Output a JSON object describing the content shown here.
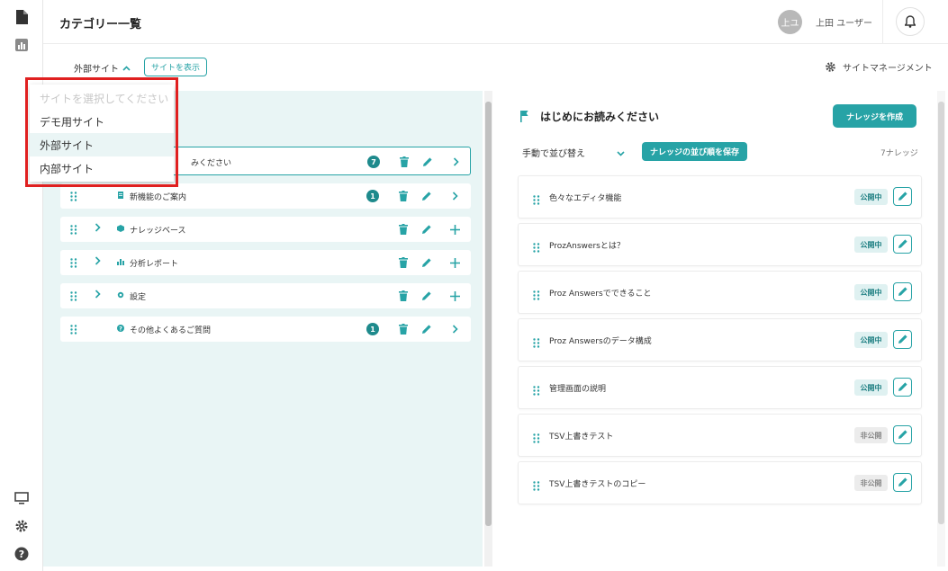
{
  "header": {
    "title": "カテゴリー一覧",
    "avatar_text": "上ユ",
    "user_name": "上田 ユーザー"
  },
  "toolbar": {
    "site_label": "外部サイト",
    "show_site": "サイトを表示",
    "site_management": "サイトマネージメント"
  },
  "dropdown": {
    "placeholder": "サイトを選択してください",
    "options": [
      "デモ用サイト",
      "外部サイト",
      "内部サイト"
    ],
    "active_index": 1
  },
  "categories": [
    {
      "label": "みください",
      "badge": "7",
      "icon": "document-icon",
      "expandable": false,
      "selected": true
    },
    {
      "label": "新機能のご案内",
      "badge": "1",
      "icon": "document-icon",
      "expandable": false
    },
    {
      "label": "ナレッジベース",
      "badge": "",
      "icon": "cube-icon",
      "expandable": true
    },
    {
      "label": "分析レポート",
      "badge": "",
      "icon": "chart-icon",
      "expandable": true
    },
    {
      "label": "設定",
      "badge": "",
      "icon": "gear-icon",
      "expandable": true
    },
    {
      "label": "その他よくあるご質問",
      "badge": "1",
      "icon": "question-icon",
      "expandable": false
    }
  ],
  "knowledge": {
    "category_title": "はじめにお読みください",
    "create_button": "ナレッジを作成",
    "sort_label": "手動で並び替え",
    "save_order_button": "ナレッジの並び順を保存",
    "count_label": "7ナレッジ",
    "items": [
      {
        "title": "色々なエディタ機能",
        "status": "公開中",
        "published": true
      },
      {
        "title": "ProzAnswersとは？",
        "status": "公開中",
        "published": true
      },
      {
        "title": "Proz Answersでできること",
        "status": "公開中",
        "published": true
      },
      {
        "title": "Proz Answersのデータ構成",
        "status": "公開中",
        "published": true
      },
      {
        "title": "管理画面の説明",
        "status": "公開中",
        "published": true
      },
      {
        "title": "TSV上書きテスト",
        "status": "非公開",
        "published": false
      },
      {
        "title": "TSV上書きテストのコピー",
        "status": "非公開",
        "published": false
      }
    ]
  },
  "colors": {
    "accent": "#27a3a6",
    "highlight": "#e02020"
  }
}
